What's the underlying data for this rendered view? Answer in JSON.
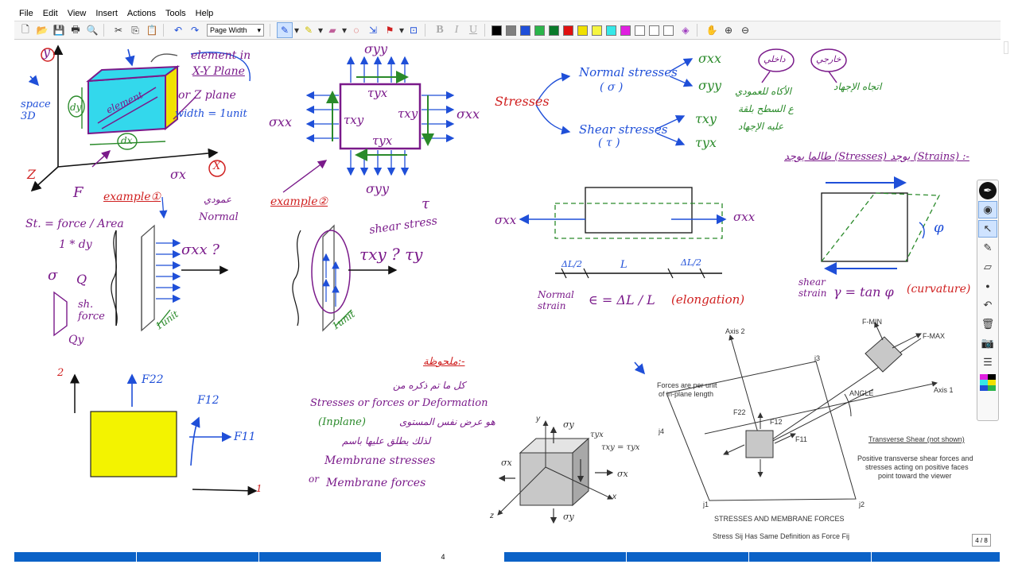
{
  "menu": [
    "File",
    "Edit",
    "View",
    "Insert",
    "Actions",
    "Tools",
    "Help"
  ],
  "toolbar": {
    "zoom_value": "Page Width",
    "colors": [
      "#000000",
      "#7f7f7f",
      "#1f4fd8",
      "#2bb54a",
      "#0a7a2a",
      "#e01010",
      "#f0e000",
      "#f5f540",
      "#35e8e8",
      "#e020e0",
      "#ffffff",
      "#ffffff",
      "#ffffff"
    ]
  },
  "notes": {
    "y_label": "y",
    "element_in": "element in",
    "xy_plane": "X-Y Plane",
    "or_z_plane": "or Z plane",
    "width_unit": "width = 1unit",
    "element_tag": "element",
    "dy": "dy",
    "dx": "dx",
    "space_3d": "space 3D",
    "z_axis": "Z",
    "x_axis": "X",
    "sigma_x": "σx",
    "sigma_xx_1": "σxx",
    "sigma_yy_top": "σyy",
    "sigma_yy_bottom": "σyy",
    "sigma_xx_right": "σxx",
    "tau_yx_top": "τyx",
    "tau_xy_left": "τxy",
    "tau_xy_right": "τxy",
    "tau_yx_bottom": "τyx",
    "stresses": "Stresses",
    "normal_stresses": "Normal stresses",
    "normal_sym": "( σ )",
    "shear_stresses": "Shear stresses",
    "shear_sym": "( τ )",
    "s_xx": "σxx",
    "s_yy": "σyy",
    "t_xy": "τxy",
    "t_yx": "τyx",
    "arabic_1": "داخلي",
    "arabic_2": "خارجي",
    "arabic_3": "الأكاه للعمودي",
    "arabic_4": "ع السطح بلقة",
    "arabic_5": "عليه الإجهاد",
    "arabic_6": "اتجاه الإجهاد",
    "strains_note": "طالما يوجد (Stresses) يوجد (Strains) :-",
    "example1": "example①",
    "example2": "example②",
    "F": "F",
    "st_formula": "St. = force / Area",
    "one_dy": "1 * dy",
    "arabic_normal": "عمودي",
    "normal_word": "Normal",
    "sigma_xx_q": "σxx ?",
    "unit1": "1unit",
    "unit2": "1unit",
    "sigma_q": "σ",
    "Q": "Q",
    "sh_force": "sh. force",
    "Qy": "Qy",
    "shear_stress": "shear stress",
    "tau": "τ",
    "tau_xy_q": "τxy ? τy",
    "sigma_xx_bar_l": "σxx",
    "sigma_xx_bar_r": "σxx",
    "dl2_l": "ΔL/2",
    "L": "L",
    "dl2_r": "ΔL/2",
    "normal_strain": "Normal strain",
    "strain_formula": "∈ = ΔL / L",
    "elongation": "(elongation)",
    "phi": "φ",
    "shear_strain": "shear strain",
    "gamma_formula": "γ = tan φ",
    "curvature": "(curvature)",
    "num_2": "2",
    "F22": "F22",
    "F12": "F12",
    "F11": "F11",
    "num_1": "1",
    "arabic_note": "ملحوظة:-",
    "arabic_line1": "كل ما تم ذكره من",
    "stresses_or": "Stresses or forces or Deformation",
    "inplane": "(Inplane)",
    "arabic_line2": "هو عرض نفس المستوى",
    "arabic_line3": "لذلك يطلق عليها باسم",
    "membrane_stresses": "Membrane stresses",
    "or_word": "or",
    "membrane_forces": "Membrane forces",
    "cube_sy_top": "σy",
    "cube_tyx": "τyx",
    "cube_eq": "τxy = τyx",
    "cube_sx_left": "σx",
    "cube_sx_right": "σx",
    "cube_sy_bot": "σy",
    "cube_y": "y",
    "cube_x": "x",
    "cube_z": "z",
    "axis2": "Axis 2",
    "fmin": "F-MIN",
    "fmax": "F-MAX",
    "j3": "j3",
    "forces_per_unit": "Forces are per unit",
    "of_inplane": "of in-plane length",
    "angle": "ANGLE",
    "axis1": "Axis 1",
    "j4": "j4",
    "f22": "F22",
    "f12": "F12",
    "f11": "F11",
    "transverse_shear": "Transverse Shear (not shown)",
    "pos_line1": "Positive transverse shear forces and",
    "pos_line2": "stresses acting on positive faces",
    "pos_line3": "point toward the viewer",
    "j1": "j1",
    "j2": "j2",
    "stresses_membrane": "STRESSES AND MEMBRANE FORCES",
    "stress_def": "Stress Sij Has Same Definition as Force Fij"
  },
  "status": {
    "page_number": "4",
    "page_indicator": "4 / 8"
  }
}
